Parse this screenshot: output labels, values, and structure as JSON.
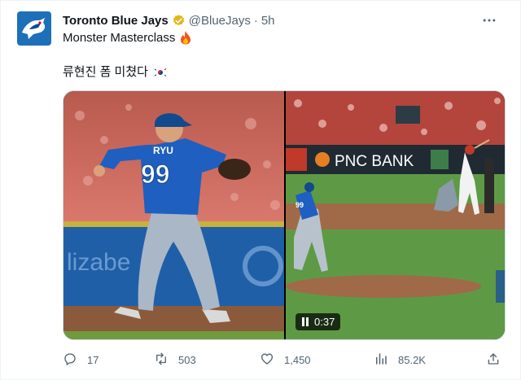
{
  "tweet": {
    "author_name": "Toronto Blue Jays",
    "handle": "@BlueJays",
    "separator": "·",
    "time": "5h",
    "text_line1": "Monster Masterclass",
    "text_line2": "류현진 폼 미쳤다"
  },
  "media": {
    "photo_jersey_name": "RYU",
    "photo_jersey_number": "99",
    "video_banner_text": "PNC BANK",
    "video_duration": "0:37"
  },
  "actions": {
    "replies": "17",
    "reposts": "503",
    "likes": "1,450",
    "views": "85.2K"
  },
  "colors": {
    "accent": "#1d9bf0",
    "verified_badge": "#e2b719",
    "jays_blue": "#134a8e",
    "muted_text": "#536471"
  }
}
